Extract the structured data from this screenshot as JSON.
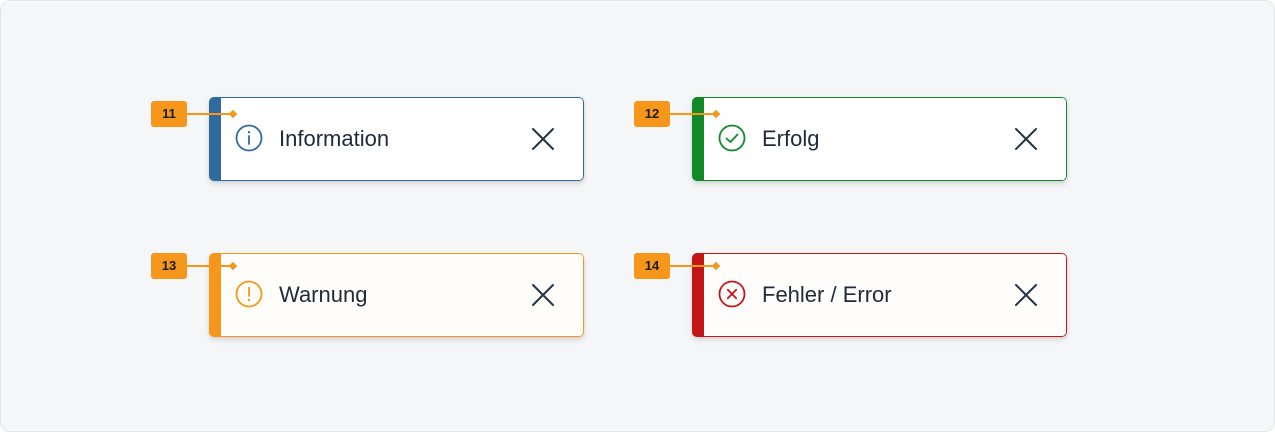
{
  "colors": {
    "info": "#2f6b9e",
    "success": "#0f8a27",
    "warning": "#f6971b",
    "error": "#c31616",
    "badge": "#f6971b",
    "text": "#1f2a3a",
    "close": "#243447"
  },
  "callouts": [
    {
      "number": "11"
    },
    {
      "number": "12"
    },
    {
      "number": "13"
    },
    {
      "number": "14"
    }
  ],
  "toasts": [
    {
      "type": "info",
      "icon": "info-icon",
      "message": "Information",
      "close_icon": "close-icon"
    },
    {
      "type": "success",
      "icon": "check-circle-icon",
      "message": "Erfolg",
      "close_icon": "close-icon"
    },
    {
      "type": "warning",
      "icon": "warning-icon",
      "message": "Warnung",
      "close_icon": "close-icon"
    },
    {
      "type": "error",
      "icon": "error-circle-icon",
      "message": "Fehler / Error",
      "close_icon": "close-icon"
    }
  ]
}
